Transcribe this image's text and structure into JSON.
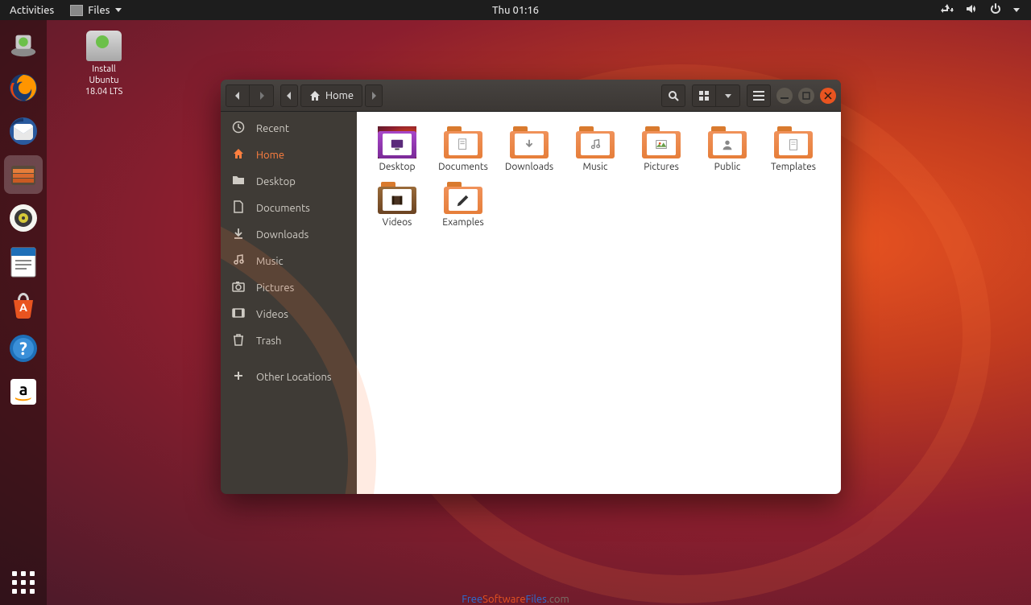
{
  "topbar": {
    "activities": "Activities",
    "app_menu": "Files",
    "clock": "Thu 01:16"
  },
  "desktop_icon": {
    "label": "Install\nUbuntu\n18.04 LTS"
  },
  "files": {
    "path_label": "Home",
    "sidebar": [
      {
        "id": "recent",
        "label": "Recent",
        "icon": "clock"
      },
      {
        "id": "home",
        "label": "Home",
        "icon": "home",
        "active": true
      },
      {
        "id": "desktop",
        "label": "Desktop",
        "icon": "folder"
      },
      {
        "id": "documents",
        "label": "Documents",
        "icon": "doc"
      },
      {
        "id": "downloads",
        "label": "Downloads",
        "icon": "download"
      },
      {
        "id": "music",
        "label": "Music",
        "icon": "music"
      },
      {
        "id": "pictures",
        "label": "Pictures",
        "icon": "camera"
      },
      {
        "id": "videos",
        "label": "Videos",
        "icon": "video"
      },
      {
        "id": "trash",
        "label": "Trash",
        "icon": "trash"
      },
      {
        "id": "other",
        "label": "Other Locations",
        "icon": "plus",
        "sep": true
      }
    ],
    "folders": [
      {
        "label": "Desktop",
        "variant": "desktop"
      },
      {
        "label": "Documents",
        "variant": "doc"
      },
      {
        "label": "Downloads",
        "variant": "download"
      },
      {
        "label": "Music",
        "variant": "music"
      },
      {
        "label": "Pictures",
        "variant": "pictures"
      },
      {
        "label": "Public",
        "variant": "public"
      },
      {
        "label": "Templates",
        "variant": "templates"
      },
      {
        "label": "Videos",
        "variant": "videos"
      },
      {
        "label": "Examples",
        "variant": "examples"
      }
    ]
  },
  "watermark": {
    "a": "Free",
    "b": "Software",
    "c": "Files",
    "d": ".com"
  }
}
